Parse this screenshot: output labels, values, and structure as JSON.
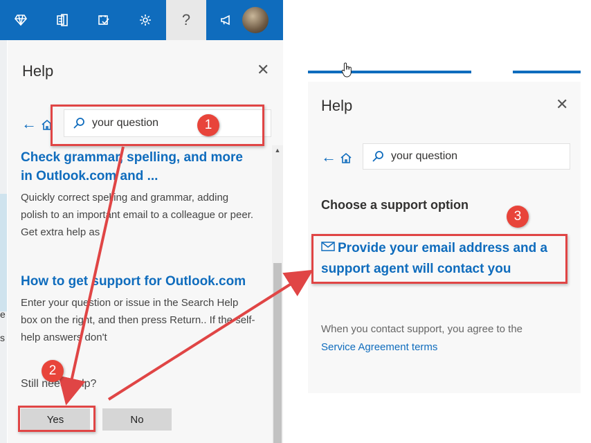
{
  "topbar": {
    "icons": [
      "diamond-icon",
      "office-apps-icon",
      "tasks-check-icon",
      "gear-icon",
      "help-icon",
      "megaphone-icon",
      "avatar"
    ],
    "help_glyph": "?"
  },
  "background": {
    "fragments": [
      "e",
      "s"
    ]
  },
  "left_pane": {
    "title": "Help",
    "search_value": "your question",
    "articles": [
      {
        "title": "Check grammar, spelling, and more in Outlook.com and ...",
        "description": "Quickly correct spelling and grammar, adding polish to an important email to a colleague or peer. Get extra help as"
      },
      {
        "title": "How to get support for Outlook.com",
        "description": "Enter your question or issue in the Search Help box on the right, and then press Return.. If the self-help answers don't"
      }
    ],
    "still_need_help": "Still need help?",
    "yes_label": "Yes",
    "no_label": "No"
  },
  "right_pane": {
    "title": "Help",
    "search_value": "your question",
    "choose_label": "Choose a support option",
    "support_link": "Provide your email address and a support agent will contact you",
    "terms_text": "When you contact support, you agree to the",
    "terms_link": "Service Agreement terms"
  },
  "annotations": {
    "badges": [
      "1",
      "2",
      "3"
    ],
    "color": "#e04545"
  },
  "colors": {
    "brand": "#0f6cbd",
    "badge": "#e8443a"
  }
}
